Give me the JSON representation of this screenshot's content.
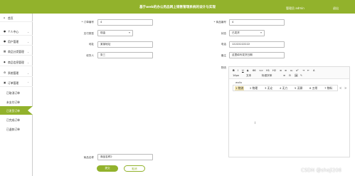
{
  "header": {
    "title": "基于web的办公用品网上销售管理系统的设计与实现",
    "user": "管理员 admin",
    "exit": "退出"
  },
  "sidebar": {
    "items": [
      {
        "label": "首页",
        "icon": "home-icon"
      },
      {
        "label": "个人中心",
        "icon": "person-icon"
      },
      {
        "label": "用户管理",
        "icon": "users-icon"
      },
      {
        "label": "商品分类管理",
        "icon": "list-icon"
      },
      {
        "label": "商品信息管理",
        "icon": "tag-icon"
      },
      {
        "label": "系统管理",
        "icon": "gear-icon"
      },
      {
        "label": "订单管理",
        "icon": "cart-icon"
      }
    ],
    "order_sub": [
      {
        "label": "已取消订单"
      },
      {
        "label": "未支付订单"
      },
      {
        "label": "已支付订单"
      },
      {
        "label": "已完成订单"
      },
      {
        "label": "已退款订单"
      },
      {
        "label": "已发货订单"
      }
    ]
  },
  "form": {
    "order_no_label": "* 订单编号",
    "order_no_value": "4",
    "product_no_label": "* 商品编号",
    "product_no_value": "4",
    "pay_type_label": "支付类型",
    "pay_type_value": "现金",
    "status_label": "状态",
    "status_value": "已发货",
    "address_label": "地址",
    "address_value": "某某地址",
    "phone_label": "电话",
    "phone_value": "12222222222",
    "receiver_label": "收货人",
    "receiver_value": "张三",
    "remark_label": "备注",
    "remark_value": "这里填写发货日期",
    "detail_label": "物流",
    "product_name_label": "商品名称",
    "product_name_value": "商品名称2"
  },
  "editor": {
    "row1": [
      "B",
      "I",
      "U",
      "S",
      "66",
      "<>",
      "H1",
      "H2",
      "≡",
      "≡",
      "x₂",
      "x²",
      "⇥",
      "⇤",
      "A"
    ],
    "row2": [
      "14px",
      "文本",
      "标准字体",
      "≡",
      "⊡",
      "🖼",
      "✎"
    ],
    "ime_composition": "wuliu",
    "candidates": [
      "1 物流",
      "2 物理",
      "3 无论",
      "4 无力",
      "5 无聊",
      "6 五常",
      "7 物料"
    ],
    "prev": "<",
    "next": ">",
    "caret": "I"
  },
  "buttons": {
    "save": "提交",
    "cancel": "取消"
  },
  "watermark": "CSDN @sheji206"
}
